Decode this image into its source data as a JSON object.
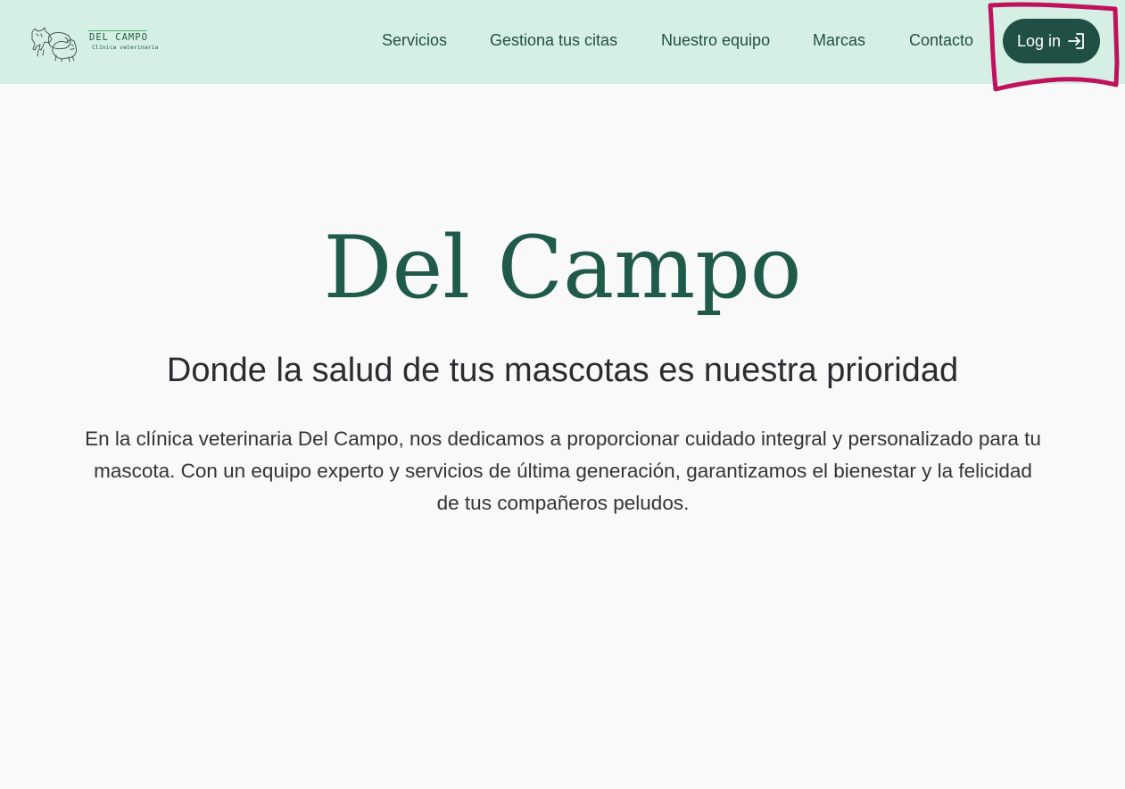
{
  "brand": {
    "name": "DEL CAMPO",
    "tagline": "Clínica veterinaria",
    "logo_icon": "pets-illustration-icon"
  },
  "nav": {
    "items": [
      {
        "label": "Servicios"
      },
      {
        "label": "Gestiona tus citas"
      },
      {
        "label": "Nuestro equipo"
      },
      {
        "label": "Marcas"
      },
      {
        "label": "Contacto"
      }
    ],
    "login": {
      "label": "Log in",
      "icon": "login-arrow-icon"
    }
  },
  "hero": {
    "title": "Del Campo",
    "subtitle": "Donde la salud de tus mascotas es nuestra prioridad",
    "body": "En la clínica veterinaria Del Campo, nos dedicamos a proporcionar cuidado integral y personalizado para tu mascota. Con un equipo experto y servicios de última generación, garantizamos el bienestar y la felicidad de tus compañeros peludos."
  },
  "colors": {
    "navbar_bg": "#d6efe4",
    "page_bg": "#f9f9f9",
    "accent": "#1f4f45",
    "title": "#1f5a4b",
    "annotation": "#c0115c"
  }
}
